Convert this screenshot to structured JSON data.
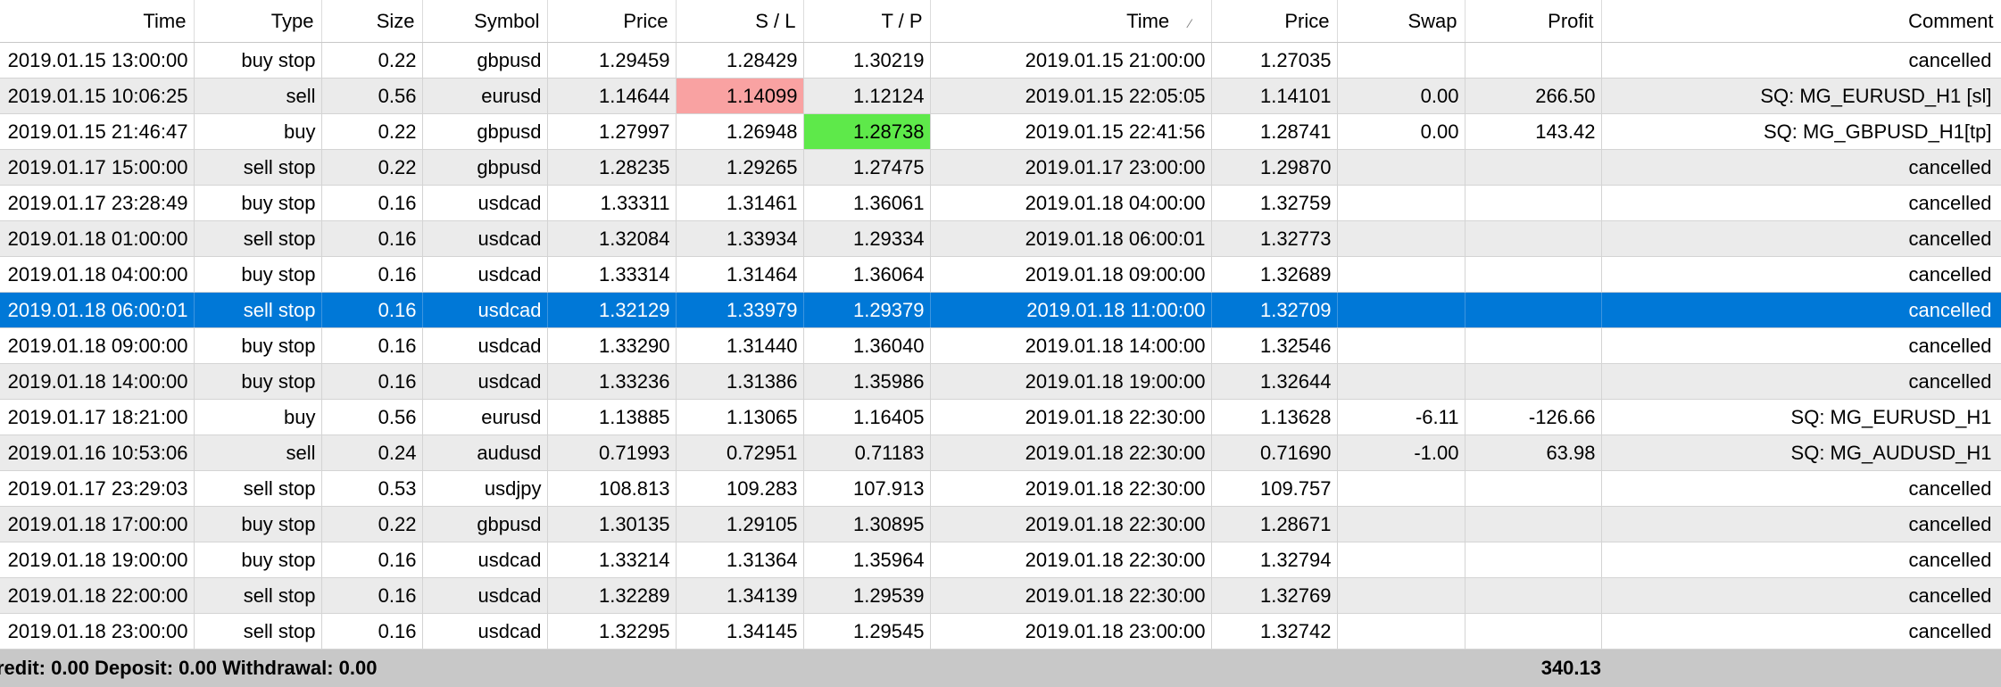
{
  "columns": [
    "Time",
    "Type",
    "Size",
    "Symbol",
    "Price",
    "S / L",
    "T / P",
    "Time",
    "Price",
    "Swap",
    "Profit",
    "Comment"
  ],
  "sorted_column_icon": "sort-indicator-icon",
  "rows": [
    {
      "open_time": "2019.01.15 13:00:00",
      "type": "buy stop",
      "size": "0.22",
      "symbol": "gbpusd",
      "price": "1.29459",
      "sl": "1.28429",
      "tp": "1.30219",
      "close_time": "2019.01.15 21:00:00",
      "close_price": "1.27035",
      "swap": "",
      "profit": "",
      "comment": "cancelled"
    },
    {
      "open_time": "2019.01.15 10:06:25",
      "type": "sell",
      "size": "0.56",
      "symbol": "eurusd",
      "price": "1.14644",
      "sl": "1.14099",
      "tp": "1.12124",
      "close_time": "2019.01.15 22:05:05",
      "close_price": "1.14101",
      "swap": "0.00",
      "profit": "266.50",
      "comment": "SQ: MG_EURUSD_H1 [sl]"
    },
    {
      "open_time": "2019.01.15 21:46:47",
      "type": "buy",
      "size": "0.22",
      "symbol": "gbpusd",
      "price": "1.27997",
      "sl": "1.26948",
      "tp": "1.28738",
      "close_time": "2019.01.15 22:41:56",
      "close_price": "1.28741",
      "swap": "0.00",
      "profit": "143.42",
      "comment": "SQ: MG_GBPUSD_H1[tp]"
    },
    {
      "open_time": "2019.01.17 15:00:00",
      "type": "sell stop",
      "size": "0.22",
      "symbol": "gbpusd",
      "price": "1.28235",
      "sl": "1.29265",
      "tp": "1.27475",
      "close_time": "2019.01.17 23:00:00",
      "close_price": "1.29870",
      "swap": "",
      "profit": "",
      "comment": "cancelled"
    },
    {
      "open_time": "2019.01.17 23:28:49",
      "type": "buy stop",
      "size": "0.16",
      "symbol": "usdcad",
      "price": "1.33311",
      "sl": "1.31461",
      "tp": "1.36061",
      "close_time": "2019.01.18 04:00:00",
      "close_price": "1.32759",
      "swap": "",
      "profit": "",
      "comment": "cancelled"
    },
    {
      "open_time": "2019.01.18 01:00:00",
      "type": "sell stop",
      "size": "0.16",
      "symbol": "usdcad",
      "price": "1.32084",
      "sl": "1.33934",
      "tp": "1.29334",
      "close_time": "2019.01.18 06:00:01",
      "close_price": "1.32773",
      "swap": "",
      "profit": "",
      "comment": "cancelled"
    },
    {
      "open_time": "2019.01.18 04:00:00",
      "type": "buy stop",
      "size": "0.16",
      "symbol": "usdcad",
      "price": "1.33314",
      "sl": "1.31464",
      "tp": "1.36064",
      "close_time": "2019.01.18 09:00:00",
      "close_price": "1.32689",
      "swap": "",
      "profit": "",
      "comment": "cancelled"
    },
    {
      "open_time": "2019.01.18 06:00:01",
      "type": "sell stop",
      "size": "0.16",
      "symbol": "usdcad",
      "price": "1.32129",
      "sl": "1.33979",
      "tp": "1.29379",
      "close_time": "2019.01.18 11:00:00",
      "close_price": "1.32709",
      "swap": "",
      "profit": "",
      "comment": "cancelled",
      "selected": true
    },
    {
      "open_time": "2019.01.18 09:00:00",
      "type": "buy stop",
      "size": "0.16",
      "symbol": "usdcad",
      "price": "1.33290",
      "sl": "1.31440",
      "tp": "1.36040",
      "close_time": "2019.01.18 14:00:00",
      "close_price": "1.32546",
      "swap": "",
      "profit": "",
      "comment": "cancelled"
    },
    {
      "open_time": "2019.01.18 14:00:00",
      "type": "buy stop",
      "size": "0.16",
      "symbol": "usdcad",
      "price": "1.33236",
      "sl": "1.31386",
      "tp": "1.35986",
      "close_time": "2019.01.18 19:00:00",
      "close_price": "1.32644",
      "swap": "",
      "profit": "",
      "comment": "cancelled"
    },
    {
      "open_time": "2019.01.17 18:21:00",
      "type": "buy",
      "size": "0.56",
      "symbol": "eurusd",
      "price": "1.13885",
      "sl": "1.13065",
      "tp": "1.16405",
      "close_time": "2019.01.18 22:30:00",
      "close_price": "1.13628",
      "swap": "-6.11",
      "profit": "-126.66",
      "comment": "SQ: MG_EURUSD_H1"
    },
    {
      "open_time": "2019.01.16 10:53:06",
      "type": "sell",
      "size": "0.24",
      "symbol": "audusd",
      "price": "0.71993",
      "sl": "0.72951",
      "tp": "0.71183",
      "close_time": "2019.01.18 22:30:00",
      "close_price": "0.71690",
      "swap": "-1.00",
      "profit": "63.98",
      "comment": "SQ: MG_AUDUSD_H1"
    },
    {
      "open_time": "2019.01.17 23:29:03",
      "type": "sell stop",
      "size": "0.53",
      "symbol": "usdjpy",
      "price": "108.813",
      "sl": "109.283",
      "tp": "107.913",
      "close_time": "2019.01.18 22:30:00",
      "close_price": "109.757",
      "swap": "",
      "profit": "",
      "comment": "cancelled"
    },
    {
      "open_time": "2019.01.18 17:00:00",
      "type": "buy stop",
      "size": "0.22",
      "symbol": "gbpusd",
      "price": "1.30135",
      "sl": "1.29105",
      "tp": "1.30895",
      "close_time": "2019.01.18 22:30:00",
      "close_price": "1.28671",
      "swap": "",
      "profit": "",
      "comment": "cancelled"
    },
    {
      "open_time": "2019.01.18 19:00:00",
      "type": "buy stop",
      "size": "0.16",
      "symbol": "usdcad",
      "price": "1.33214",
      "sl": "1.31364",
      "tp": "1.35964",
      "close_time": "2019.01.18 22:30:00",
      "close_price": "1.32794",
      "swap": "",
      "profit": "",
      "comment": "cancelled"
    },
    {
      "open_time": "2019.01.18 22:00:00",
      "type": "sell stop",
      "size": "0.16",
      "symbol": "usdcad",
      "price": "1.32289",
      "sl": "1.34139",
      "tp": "1.29539",
      "close_time": "2019.01.18 22:30:00",
      "close_price": "1.32769",
      "swap": "",
      "profit": "",
      "comment": "cancelled"
    },
    {
      "open_time": "2019.01.18 23:00:00",
      "type": "sell stop",
      "size": "0.16",
      "symbol": "usdcad",
      "price": "1.32295",
      "sl": "1.34145",
      "tp": "1.29545",
      "close_time": "2019.01.18 23:00:00",
      "close_price": "1.32742",
      "swap": "",
      "profit": "",
      "comment": "cancelled"
    }
  ],
  "highlights": {
    "sl_hit_color": "#f9a2a2",
    "tp_hit_color": "#5ee94a",
    "selected_row_color": "#0078d7",
    "sl_hit_rows": [
      1
    ],
    "tp_hit_rows": [
      2
    ]
  },
  "summary": {
    "balance_text": "redit: 0.00  Deposit: 0.00  Withdrawal: 0.00",
    "total_profit": "340.13"
  }
}
